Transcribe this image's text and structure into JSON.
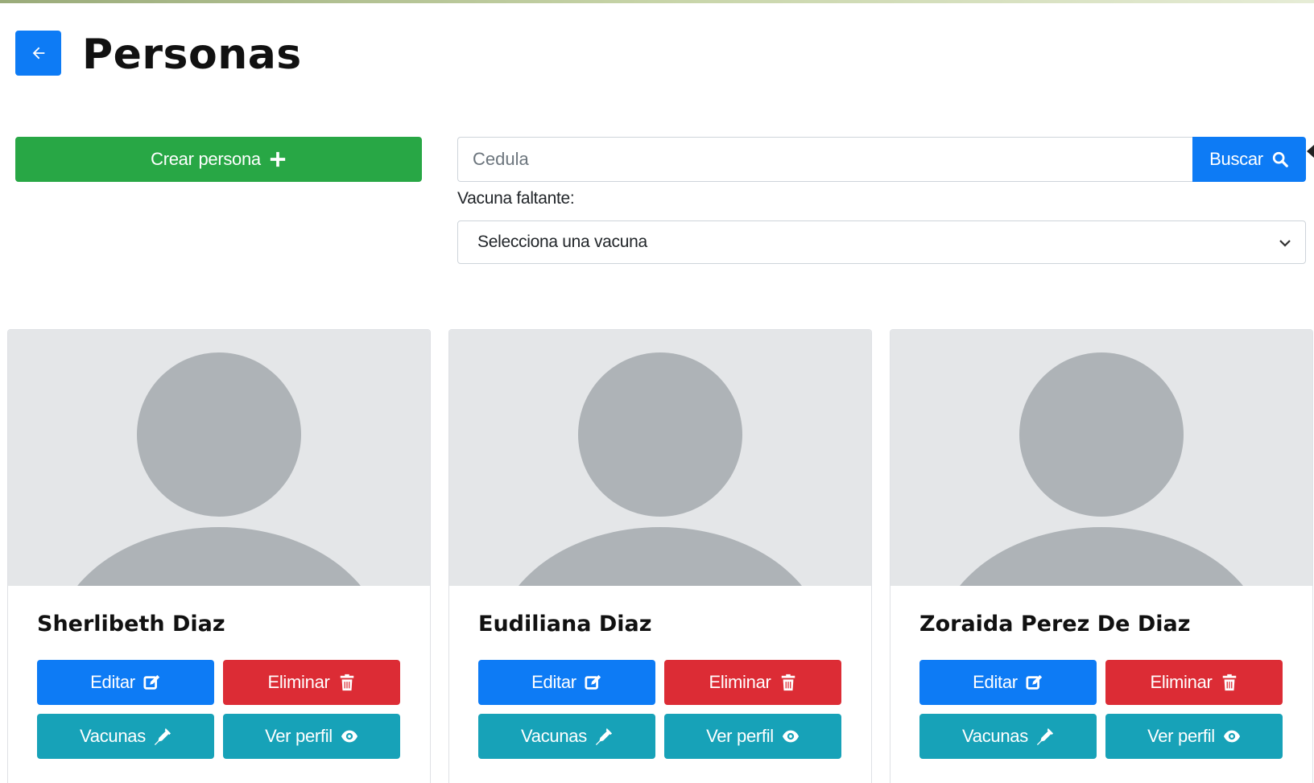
{
  "header": {
    "title": "Personas"
  },
  "actions": {
    "create_label": "Crear persona"
  },
  "search": {
    "placeholder": "Cedula",
    "button_label": "Buscar"
  },
  "filter": {
    "label": "Vacuna faltante:",
    "selected": "Selecciona una vacuna"
  },
  "people": [
    {
      "name": "Sherlibeth Diaz",
      "buttons": {
        "edit": "Editar",
        "delete": "Eliminar",
        "vaccines": "Vacunas",
        "profile": "Ver perfil"
      }
    },
    {
      "name": "Eudiliana Diaz",
      "buttons": {
        "edit": "Editar",
        "delete": "Eliminar",
        "vaccines": "Vacunas",
        "profile": "Ver perfil"
      }
    },
    {
      "name": "Zoraida Perez De Diaz",
      "buttons": {
        "edit": "Editar",
        "delete": "Eliminar",
        "vaccines": "Vacunas",
        "profile": "Ver perfil"
      }
    }
  ],
  "icons": {
    "back": "arrow-left-icon",
    "create": "plus-icon",
    "search": "search-icon",
    "select": "chevron-down-icon",
    "edit": "edit-icon",
    "delete": "trash-icon",
    "vaccines": "syringe-icon",
    "profile": "eye-icon",
    "avatar": "avatar-placeholder-icon"
  },
  "colors": {
    "primary": "#0d7bf5",
    "success": "#28a745",
    "danger": "#dc2c35",
    "info": "#17a2b8",
    "avatar_bg": "#e4e6e8",
    "avatar_fg": "#aeb3b7"
  }
}
